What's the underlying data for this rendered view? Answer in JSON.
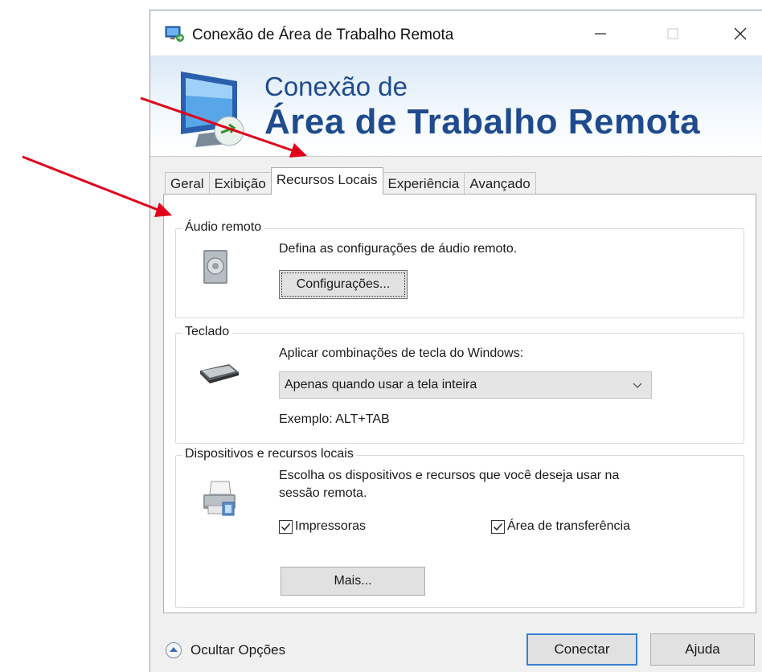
{
  "window": {
    "title": "Conexão de Área de Trabalho Remota",
    "controls": {
      "minimize": "minimize-icon",
      "maximize": "maximize-icon",
      "close": "close-icon"
    }
  },
  "banner": {
    "line1": "Conexão de",
    "line2": "Área de Trabalho Remota"
  },
  "tabs": [
    {
      "label": "Geral",
      "active": false
    },
    {
      "label": "Exibição",
      "active": false
    },
    {
      "label": "Recursos Locais",
      "active": true
    },
    {
      "label": "Experiência",
      "active": false
    },
    {
      "label": "Avançado",
      "active": false
    }
  ],
  "audio": {
    "group_label": "Áudio remoto",
    "description": "Defina as configurações de áudio remoto.",
    "button_label": "Configurações...",
    "icon": "speaker-icon"
  },
  "keyboard": {
    "group_label": "Teclado",
    "description": "Aplicar combinações de tecla do Windows:",
    "selected_option": "Apenas quando usar a tela inteira",
    "example": "Exemplo: ALT+TAB",
    "icon": "keyboard-icon"
  },
  "devices": {
    "group_label": "Dispositivos e recursos locais",
    "description_line1": "Escolha os dispositivos e recursos que você deseja usar na",
    "description_line2": "sessão remota.",
    "printers_label": "Impressoras",
    "printers_checked": true,
    "clipboard_label": "Área de transferência",
    "clipboard_checked": true,
    "more_label": "Mais...",
    "icon": "printer-icon"
  },
  "footer": {
    "hide_options_label": "Ocultar Opções",
    "connect_label": "Conectar",
    "help_label": "Ajuda"
  },
  "colors": {
    "banner_text": "#1f4b8e",
    "annotation_arrow": "#e0001a",
    "default_button_border": "#3a7fd4"
  }
}
